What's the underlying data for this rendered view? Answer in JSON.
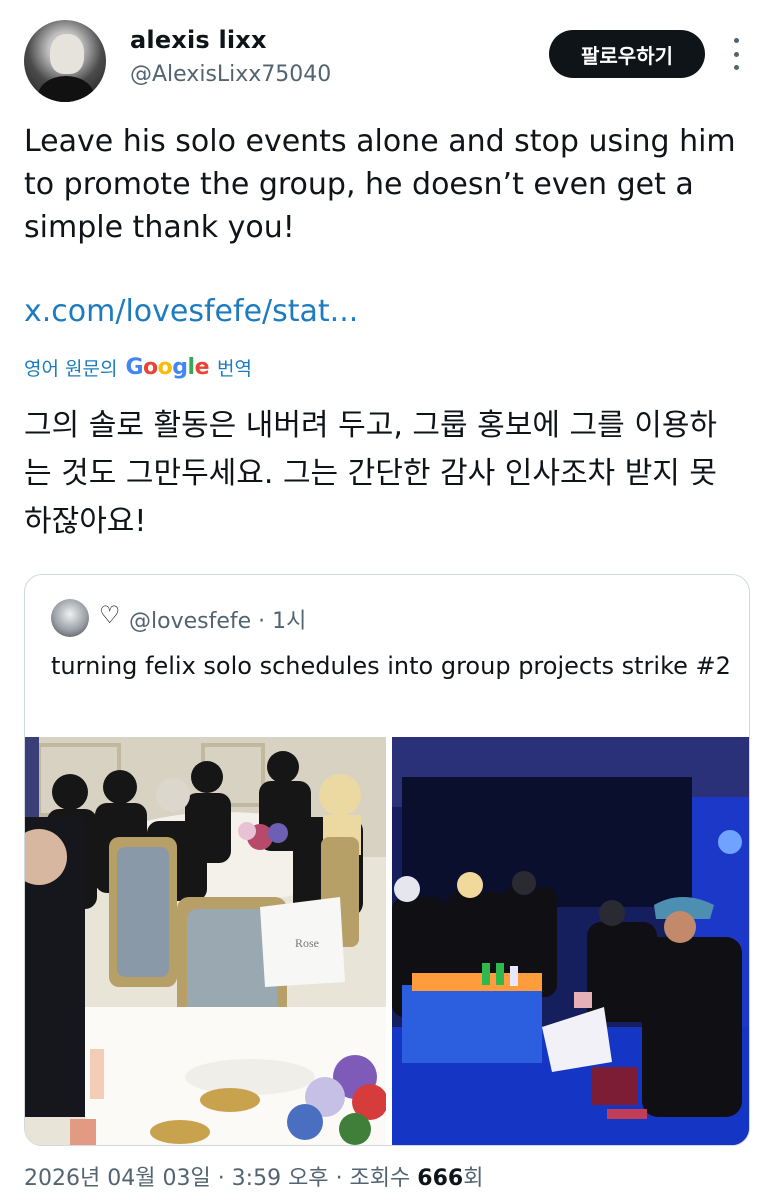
{
  "author": {
    "name": "alexis lixx",
    "handle": "@AlexisLixx75040",
    "follow_label": "팔로우하기"
  },
  "tweet": {
    "text": "Leave his solo events alone and stop using him to promote the group, he doesn’t even get a simple thank you!",
    "link": "x.com/lovesfefe/stat...",
    "translate_prefix": "영어 원문의",
    "translate_brand": "Google",
    "translate_suffix": "번역",
    "translated_text": "그의 솔로 활동은 내버려 두고, 그룹 홍보에 그를 이용하는 것도 그만두세요. 그는 간단한 감사 인사조차 받지 못하잖아요!"
  },
  "quoted": {
    "handle": "@lovesfefe",
    "time": "· 1시",
    "text": "turning felix solo schedules into group projects strike #2",
    "card_text": "Rose"
  },
  "footer": {
    "date": "2026년 04월 03일",
    "time": "· 3:59 오후",
    "views_label": "· 조회수",
    "views_count": "666",
    "views_unit": "회"
  },
  "icons": [
    "more-icon",
    "heart-icon"
  ],
  "colors": {
    "link": "#1d7bbf",
    "follow_bg": "#0f1419",
    "secondary_text": "#536471"
  }
}
